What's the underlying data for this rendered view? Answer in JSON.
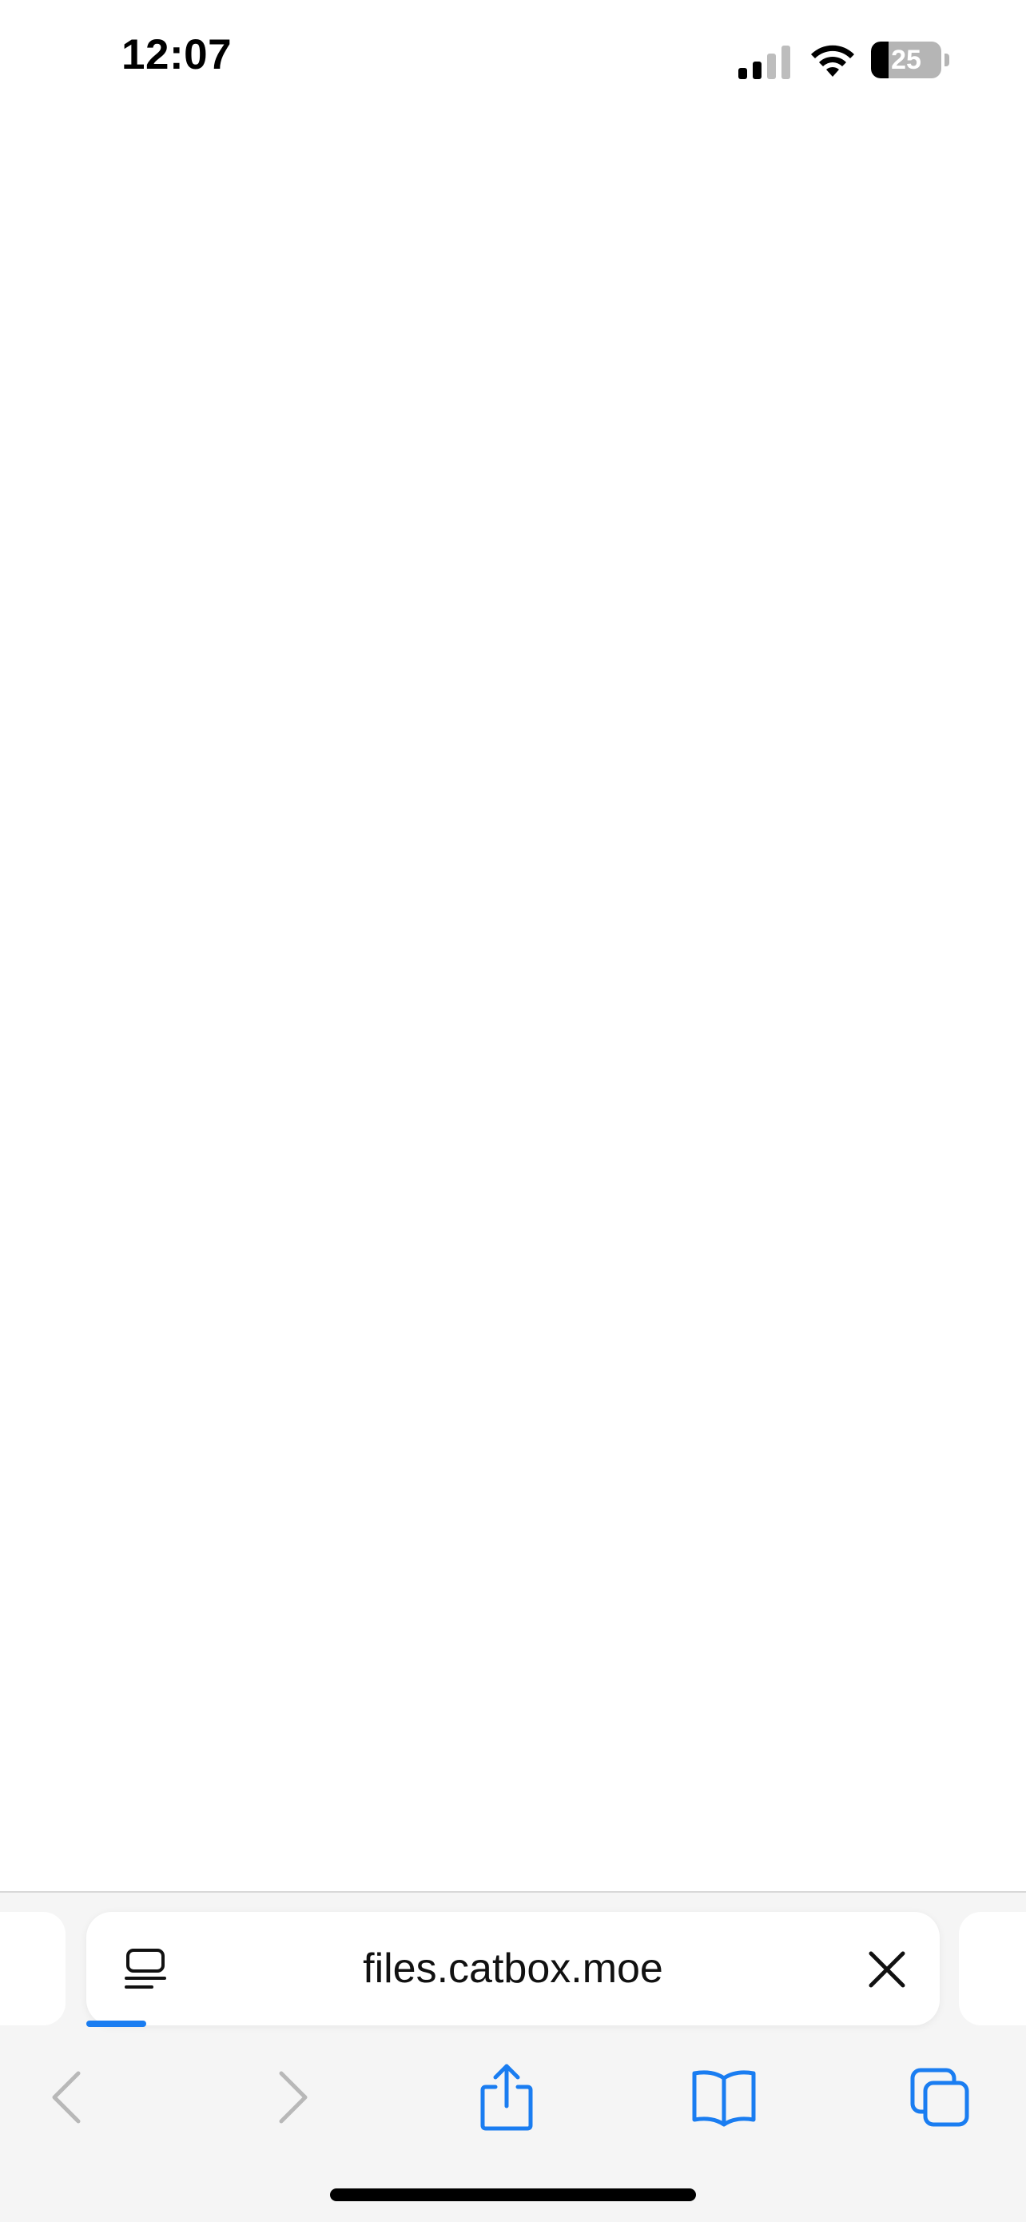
{
  "status_bar": {
    "time": "12:07",
    "battery_level": "25",
    "battery_fraction": 0.25,
    "signal_bars_active": 2,
    "signal_bars_total": 4
  },
  "address_bar": {
    "url": "files.catbox.moe",
    "load_progress_fraction": 0.07,
    "page_menu_icon": "page-format-icon",
    "close_icon": "close-icon"
  },
  "toolbar": {
    "items": [
      {
        "name": "back",
        "icon": "chevron-left-icon",
        "enabled": false
      },
      {
        "name": "forward",
        "icon": "chevron-right-icon",
        "enabled": false
      },
      {
        "name": "share",
        "icon": "share-icon",
        "enabled": true
      },
      {
        "name": "bookmarks",
        "icon": "book-icon",
        "enabled": true
      },
      {
        "name": "tabs",
        "icon": "tabs-icon",
        "enabled": true
      }
    ]
  },
  "colors": {
    "accent": "#1a7df1",
    "disabled": "#b8b8b8",
    "toolbar_bg": "#f5f5f5"
  }
}
